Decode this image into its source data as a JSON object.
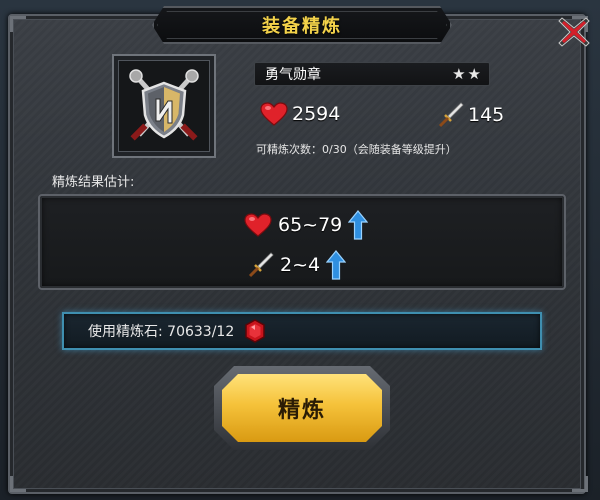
{
  "dialog": {
    "title": "装备精炼"
  },
  "item": {
    "name": "勇气勋章",
    "stars": 2,
    "icon": "shield-crossed-swords-icon",
    "hp": "2594",
    "attack": "145",
    "refine_count_text": "可精炼次数：0/30（会随装备等级提升）"
  },
  "estimate": {
    "label": "精炼结果估计:",
    "hp_range": "65~79",
    "attack_range": "2~4"
  },
  "stone": {
    "text": "使用精炼石: 70633/12",
    "icon": "red-gem-icon"
  },
  "actions": {
    "refine_label": "精炼",
    "close_icon": "close-x-icon"
  },
  "colors": {
    "title": "#f3d24a",
    "button_gold": "#f5c23a",
    "stone_border": "#3f8fb0",
    "heart": "#e0222a",
    "arrow_blue": "#2f8fe0"
  }
}
